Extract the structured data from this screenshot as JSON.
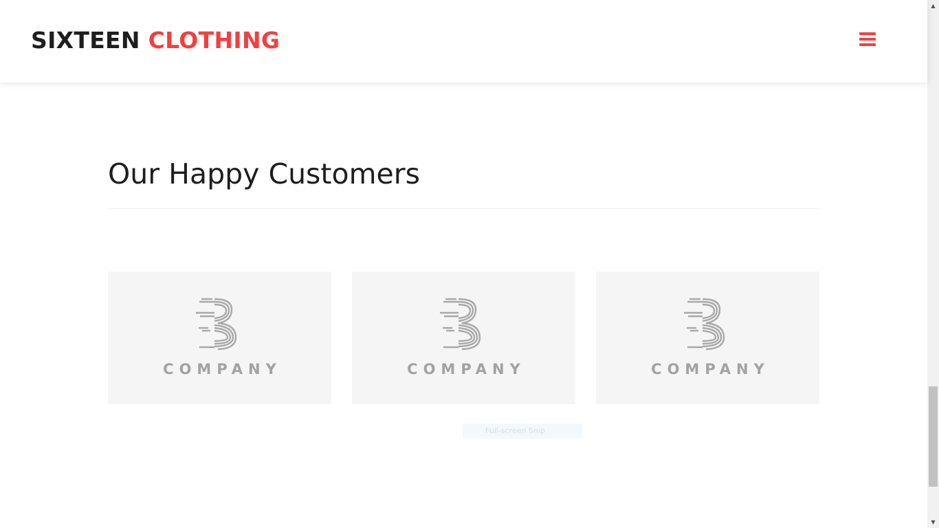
{
  "navbar": {
    "brand_part1": "SIXTEEN",
    "brand_part2": "CLOTHING",
    "menu_icon": "hamburger-menu-icon"
  },
  "section": {
    "title": "Our Happy Customers"
  },
  "clients": [
    {
      "logo_text": "COMPANY",
      "logo_icon": "company-b-logo"
    },
    {
      "logo_text": "COMPANY",
      "logo_icon": "company-b-logo"
    },
    {
      "logo_text": "COMPANY",
      "logo_icon": "company-b-logo"
    }
  ],
  "overlay": {
    "snip_label": "Full-screen Snip"
  },
  "scrollbar": {
    "up_arrow": "▲",
    "down_arrow": "▼"
  },
  "colors": {
    "accent": "#f33f3f",
    "text_dark": "#1e1e1e",
    "logo_card_bg": "#f5f5f5",
    "logo_gray": "#a2a2a2"
  }
}
